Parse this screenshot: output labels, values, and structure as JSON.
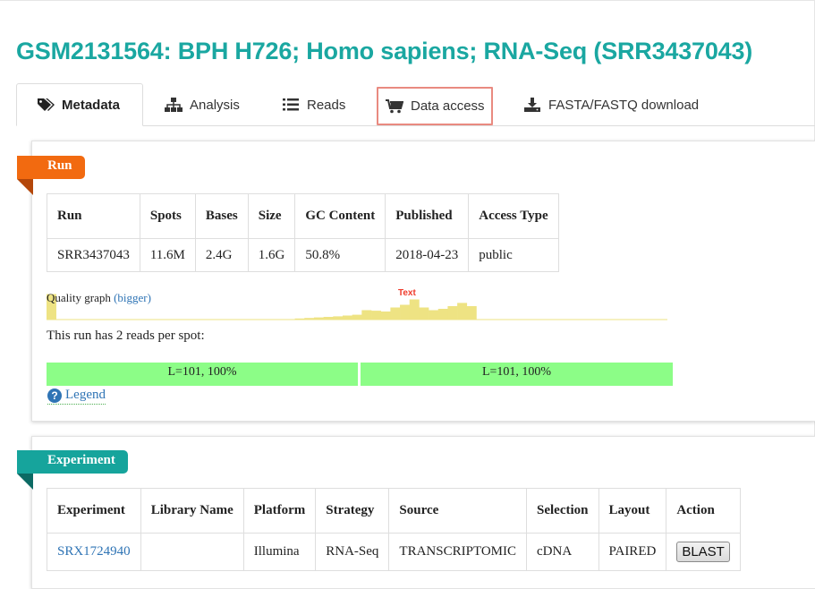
{
  "page": {
    "title": "GSM2131564: BPH H726; Homo sapiens; RNA-Seq (SRR3437043)"
  },
  "tabs": [
    {
      "label": "Metadata",
      "icon": "tags-icon",
      "active": true
    },
    {
      "label": "Analysis",
      "icon": "sitemap-icon"
    },
    {
      "label": "Reads",
      "icon": "list-icon"
    },
    {
      "label": "Data access",
      "icon": "cart-icon",
      "highlighted": true
    },
    {
      "label": "FASTA/FASTQ download",
      "icon": "download-icon"
    }
  ],
  "run": {
    "ribbon": "Run",
    "headers": [
      "Run",
      "Spots",
      "Bases",
      "Size",
      "GC Content",
      "Published",
      "Access Type"
    ],
    "row": [
      "SRR3437043",
      "11.6M",
      "2.4G",
      "1.6G",
      "50.8%",
      "2018-04-23",
      "public"
    ],
    "quality_label": "Quality graph",
    "quality_bigger": "(bigger)",
    "quality_overlay_text": "Text",
    "quality_bars": [
      0.95,
      0,
      0,
      0,
      0,
      0,
      0,
      0,
      0,
      0,
      0,
      0,
      0,
      0,
      0,
      0,
      0,
      0,
      0,
      0,
      0,
      0,
      0,
      0,
      0,
      0,
      0.04,
      0.06,
      0.08,
      0.1,
      0.12,
      0.15,
      0.18,
      0.35,
      0.33,
      0.3,
      0.45,
      0.55,
      0.75,
      0.45,
      0.35,
      0.4,
      0.5,
      0.62,
      0.5,
      0,
      0,
      0,
      0,
      0,
      0,
      0,
      0,
      0,
      0,
      0,
      0,
      0,
      0,
      0,
      0,
      0,
      0,
      0,
      0
    ],
    "reads_text": "This run has 2 reads per spot:",
    "reads": [
      "L=101, 100%",
      "L=101, 100%"
    ],
    "legend": "Legend"
  },
  "experiment": {
    "ribbon": "Experiment",
    "headers": [
      "Experiment",
      "Library Name",
      "Platform",
      "Strategy",
      "Source",
      "Selection",
      "Layout",
      "Action"
    ],
    "row": [
      "SRX1724940",
      "",
      "Illumina",
      "RNA-Seq",
      "TRANSCRIPTOMIC",
      "cDNA",
      "PAIRED"
    ],
    "action_label": "BLAST"
  },
  "colors": {
    "title": "#1aa7a1",
    "run_ribbon": "#f26a10",
    "experiment_ribbon": "#16a49c",
    "link": "#2f74b5",
    "read_bar": "#8cfd87",
    "quality_bar": "#eee383",
    "highlight_border": "#e98a80"
  }
}
